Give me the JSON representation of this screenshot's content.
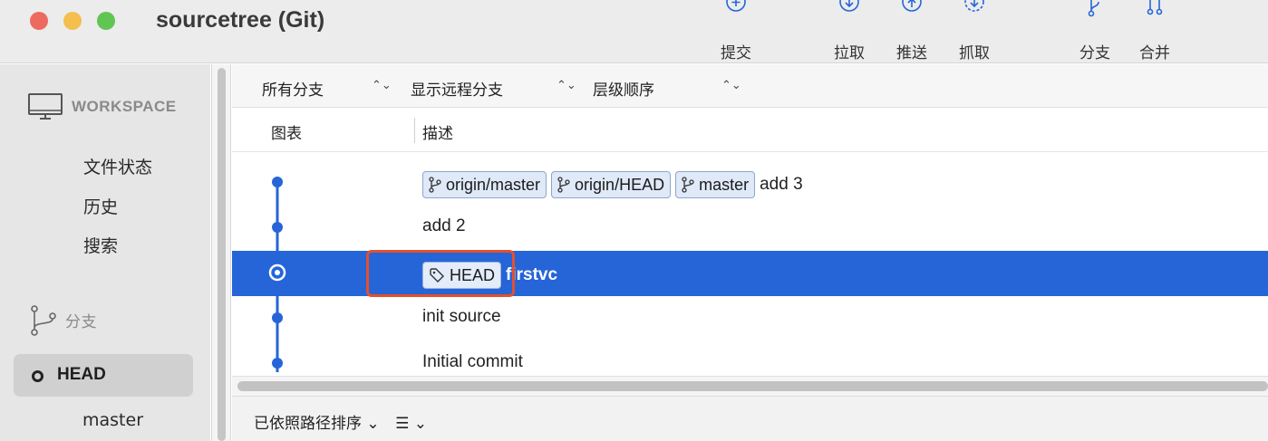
{
  "window": {
    "title": "sourcetree (Git)"
  },
  "toolbar": {
    "items": [
      {
        "label": "提交",
        "icon": "commit-icon"
      },
      {
        "label": "拉取",
        "icon": "pull-icon"
      },
      {
        "label": "推送",
        "icon": "push-icon"
      },
      {
        "label": "抓取",
        "icon": "fetch-icon"
      },
      {
        "label": "分支",
        "icon": "branch-icon"
      },
      {
        "label": "合并",
        "icon": "merge-icon"
      }
    ]
  },
  "sidebar": {
    "workspace_label": "WORKSPACE",
    "workspace_items": [
      "文件状态",
      "历史",
      "搜索"
    ],
    "branches_label": "分支",
    "branches": [
      {
        "name": "HEAD",
        "selected": true
      },
      {
        "name": "master",
        "selected": false
      }
    ]
  },
  "filters": {
    "branch_scope": "所有分支",
    "remote_branches": "显示远程分支",
    "order": "层级顺序"
  },
  "columns": {
    "graph": "图表",
    "description": "描述"
  },
  "commits": [
    {
      "refs": [
        "origin/master",
        "origin/HEAD",
        "master"
      ],
      "tags": [],
      "message": "add 3",
      "selected": false
    },
    {
      "refs": [],
      "tags": [],
      "message": "add 2",
      "selected": false
    },
    {
      "refs": [],
      "tags": [
        "HEAD"
      ],
      "message": "firstvc",
      "selected": true
    },
    {
      "refs": [],
      "tags": [],
      "message": "init source",
      "selected": false
    },
    {
      "refs": [],
      "tags": [],
      "message": "Initial commit",
      "selected": false
    }
  ],
  "bottom": {
    "sort_label": "已依照路径排序"
  },
  "colors": {
    "selection": "#2565d8",
    "graph_line": "#2565d8",
    "highlight": "#e4502d"
  }
}
